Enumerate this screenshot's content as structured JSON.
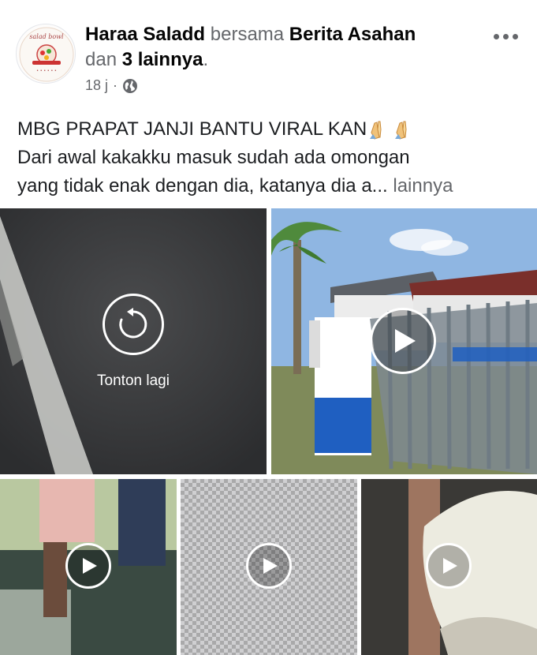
{
  "post": {
    "author": "Haraa Saladd",
    "with_word": "bersama",
    "tagged_page": "Berita Asahan",
    "and_word": "dan",
    "others": "3 lainnya",
    "period": ".",
    "time": "18 j",
    "separator": "·",
    "privacy_icon": "globe-icon",
    "menu_icon": "more-dots-icon"
  },
  "caption": {
    "title": "MBG PRAPAT JANJI BANTU VIRAL KAN",
    "emoji": "folded-hands-icon x2",
    "line2": "Dari awal kakakku masuk sudah ada omongan",
    "line3": "yang tidak enak dengan dia, katanya dia a...",
    "more_label": "lainnya"
  },
  "media": {
    "replay_label": "Tonton lagi",
    "tiles": [
      {
        "kind": "video-ended",
        "icon": "replay-icon"
      },
      {
        "kind": "video",
        "icon": "play-icon"
      },
      {
        "kind": "video",
        "icon": "play-icon"
      },
      {
        "kind": "video",
        "icon": "play-icon"
      },
      {
        "kind": "video",
        "icon": "play-icon"
      }
    ]
  },
  "colors": {
    "meta_gray": "#65676b",
    "text": "#050505",
    "link_gray": "#65676b"
  }
}
